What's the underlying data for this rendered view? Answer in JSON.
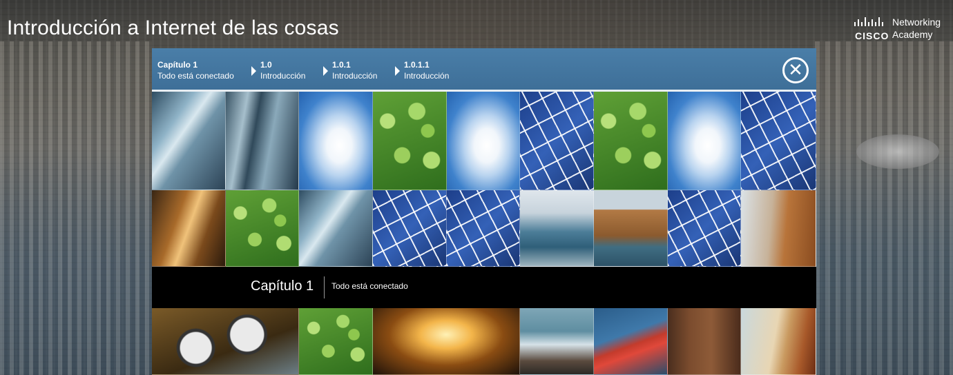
{
  "course": {
    "title": "Introducción a Internet de las cosas"
  },
  "logo": {
    "brand": "CISCO",
    "line1": "Networking",
    "line2": "Academy"
  },
  "breadcrumb": {
    "items": [
      {
        "number": "Capítulo 1",
        "label": "Todo está conectado"
      },
      {
        "number": "1.0",
        "label": "Introducción"
      },
      {
        "number": "1.0.1",
        "label": "Introducción"
      },
      {
        "number": "1.0.1.1",
        "label": "Introducción"
      }
    ],
    "close_icon": "close-circle-icon"
  },
  "banner": {
    "chapter": "Capítulo 1",
    "name": "Todo está conectado"
  },
  "colors": {
    "breadcrumb_bar": "#3e6f98",
    "band": "#000000",
    "text": "#ffffff"
  }
}
